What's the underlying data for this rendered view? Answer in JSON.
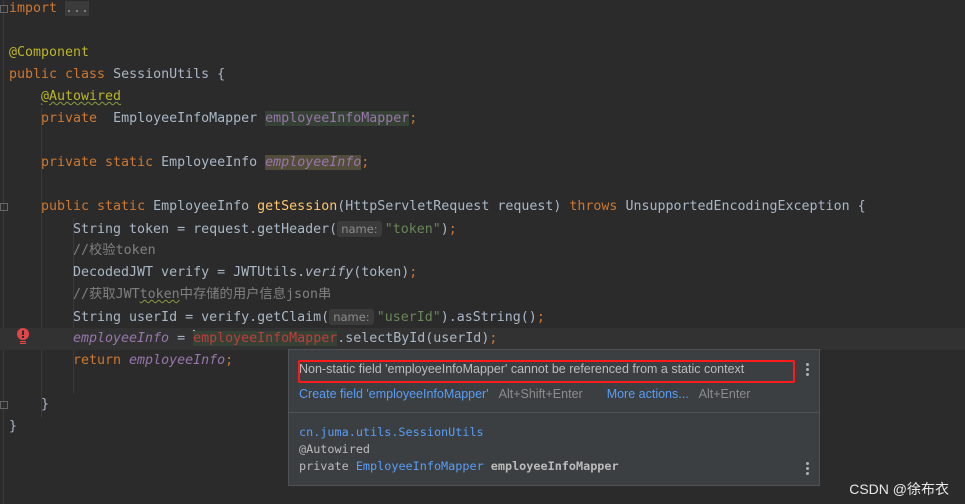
{
  "editor": {
    "lines": [
      {
        "row": 0,
        "indent": 0,
        "tokens": [
          {
            "t": "import ",
            "c": "kw"
          },
          {
            "t": "...",
            "c": "fold"
          }
        ]
      },
      {
        "row": 2,
        "indent": 0,
        "tokens": [
          {
            "t": "@Component",
            "c": "ann"
          }
        ]
      },
      {
        "row": 3,
        "indent": 0,
        "tokens": [
          {
            "t": "public class ",
            "c": "kw"
          },
          {
            "t": "SessionUtils {",
            "c": ""
          }
        ]
      },
      {
        "row": 4,
        "indent": 1,
        "tokens": [
          {
            "t": "@Autowired",
            "c": "ann squig"
          }
        ]
      },
      {
        "row": 5,
        "indent": 1,
        "tokens": [
          {
            "t": "private  ",
            "c": "kw"
          },
          {
            "t": "EmployeeInfoMapper ",
            "c": ""
          },
          {
            "t": "employeeInfoMapper",
            "c": "fld hl-green"
          },
          {
            "t": ";",
            "c": "kw"
          }
        ]
      },
      {
        "row": 7,
        "indent": 1,
        "tokens": [
          {
            "t": "private static ",
            "c": "kw"
          },
          {
            "t": "EmployeeInfo ",
            "c": ""
          },
          {
            "t": "employeeInfo",
            "c": "fld-i hl-olive"
          },
          {
            "t": ";",
            "c": "kw"
          }
        ]
      },
      {
        "row": 9,
        "indent": 1,
        "tokens": [
          {
            "t": "public static ",
            "c": "kw"
          },
          {
            "t": "EmployeeInfo ",
            "c": ""
          },
          {
            "t": "getSession",
            "c": "fn"
          },
          {
            "t": "(HttpServletRequest request) ",
            "c": ""
          },
          {
            "t": "throws ",
            "c": "kw"
          },
          {
            "t": "UnsupportedEncodingException {",
            "c": ""
          }
        ]
      },
      {
        "row": 10,
        "indent": 2,
        "tokens": [
          {
            "t": "String token = request.getHeader(",
            "c": ""
          },
          {
            "t": "name:",
            "c": "hint"
          },
          {
            "t": "\"token\"",
            "c": "str"
          },
          {
            "t": ")",
            "c": ""
          },
          {
            "t": ";",
            "c": "kw"
          }
        ]
      },
      {
        "row": 11,
        "indent": 2,
        "tokens": [
          {
            "t": "//校验token",
            "c": "cmt"
          }
        ]
      },
      {
        "row": 12,
        "indent": 2,
        "tokens": [
          {
            "t": "DecodedJWT verify = JWTUtils.",
            "c": ""
          },
          {
            "t": "verify",
            "c": "fn-i"
          },
          {
            "t": "(token)",
            "c": ""
          },
          {
            "t": ";",
            "c": "kw"
          }
        ]
      },
      {
        "row": 13,
        "indent": 2,
        "tokens": [
          {
            "t": "//获取JWT",
            "c": "cmt"
          },
          {
            "t": "token",
            "c": "cmt squig"
          },
          {
            "t": "中存储的用户信息json串",
            "c": "cmt"
          }
        ]
      },
      {
        "row": 14,
        "indent": 2,
        "tokens": [
          {
            "t": "String userId = verify.getClaim(",
            "c": ""
          },
          {
            "t": "name:",
            "c": "hint"
          },
          {
            "t": "\"userId\"",
            "c": "str"
          },
          {
            "t": ").asString()",
            "c": ""
          },
          {
            "t": ";",
            "c": "kw"
          }
        ]
      },
      {
        "row": 15,
        "indent": 2,
        "error": true,
        "tokens": [
          {
            "t": "employeeInfo",
            "c": "fld-i"
          },
          {
            "t": " = ",
            "c": ""
          },
          {
            "t": "employeeInfoMapper",
            "c": "err-ref caret-before"
          },
          {
            "t": ".selectById(userId)",
            "c": ""
          },
          {
            "t": ";",
            "c": "kw"
          }
        ]
      },
      {
        "row": 16,
        "indent": 2,
        "tokens": [
          {
            "t": "return ",
            "c": "kw"
          },
          {
            "t": "employeeInfo",
            "c": "fld-i"
          },
          {
            "t": ";",
            "c": "kw"
          }
        ]
      },
      {
        "row": 18,
        "indent": 1,
        "tokens": [
          {
            "t": "}",
            "c": ""
          }
        ]
      },
      {
        "row": 19,
        "indent": 0,
        "tokens": [
          {
            "t": "}",
            "c": ""
          }
        ]
      }
    ]
  },
  "popup": {
    "message": "Non-static field 'employeeInfoMapper' cannot be referenced from a static context",
    "action1_label": "Create field 'employeeInfoMapper'",
    "action1_shortcut": "Alt+Shift+Enter",
    "action2_label": "More actions...",
    "action2_shortcut": "Alt+Enter",
    "doc": {
      "class_path": "cn.juma.utils.SessionUtils",
      "annotation": "@Autowired",
      "modifier": "private ",
      "type": "EmployeeInfoMapper",
      "name": " employeeInfoMapper"
    }
  },
  "watermark": "CSDN @徐布衣",
  "colors": {
    "background": "#2b2b2b",
    "keyword": "#cc7832",
    "annotation": "#bbb529",
    "field": "#9876aa",
    "string": "#6a8759",
    "error": "#bc3f3c",
    "link": "#589df6",
    "highlight_box": "#ff1a1a"
  }
}
